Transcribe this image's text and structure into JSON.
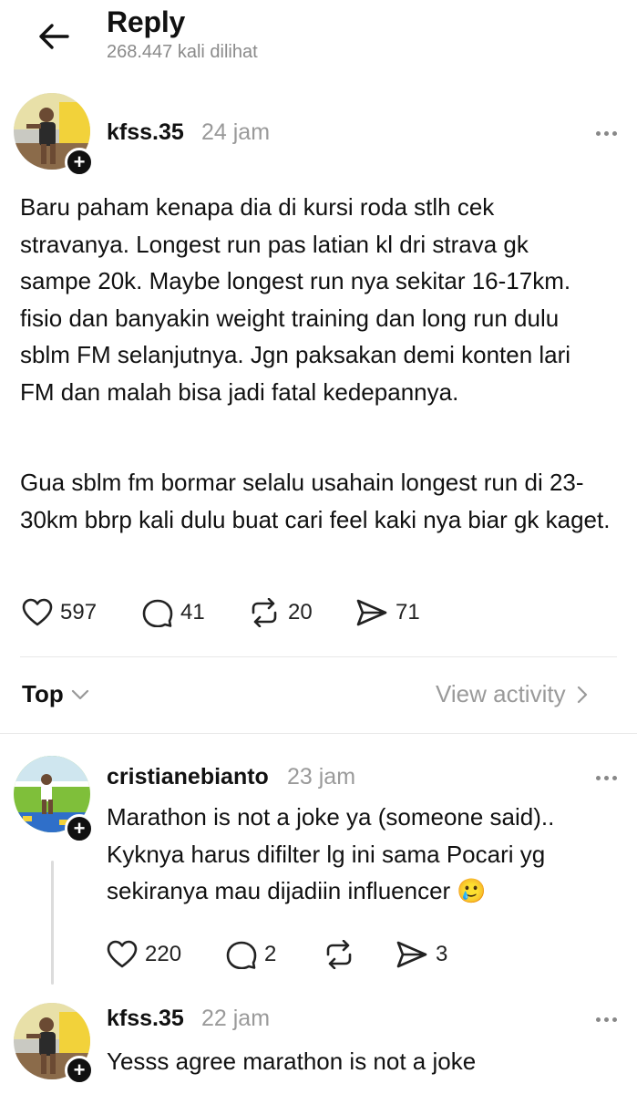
{
  "header": {
    "title": "Reply",
    "views": "268.447 kali dilihat"
  },
  "main_post": {
    "username": "kfss.35",
    "time": "24 jam",
    "paragraph1": "Baru paham kenapa dia di kursi roda stlh cek stravanya. Longest run pas latian kl dri strava gk sampe 20k. Maybe longest run nya sekitar 16-17km. fisio dan banyakin weight training dan long run dulu sblm FM selanjutnya. Jgn paksakan demi konten lari FM dan malah bisa jadi fatal kedepannya.",
    "paragraph2": "Gua sblm fm bormar selalu usahain longest run di 23-30km bbrp kali dulu buat cari feel kaki nya biar gk kaget.",
    "likes": "597",
    "comments": "41",
    "reposts": "20",
    "shares": "71"
  },
  "sort_bar": {
    "sort_label": "Top",
    "view_activity": "View activity"
  },
  "replies": [
    {
      "username": "cristianebianto",
      "time": "23 jam",
      "text": "Marathon is not a joke ya (someone said).. Kyknya harus difilter lg ini sama Pocari yg sekiranya mau dijadiin influencer 🥲",
      "likes": "220",
      "comments": "2",
      "reposts": "",
      "shares": "3"
    },
    {
      "username": "kfss.35",
      "time": "22 jam",
      "text": "Yesss agree marathon is not a joke"
    }
  ],
  "colors": {
    "text": "#111111",
    "muted": "#9a9a9a",
    "divider": "#e8e8e8"
  }
}
